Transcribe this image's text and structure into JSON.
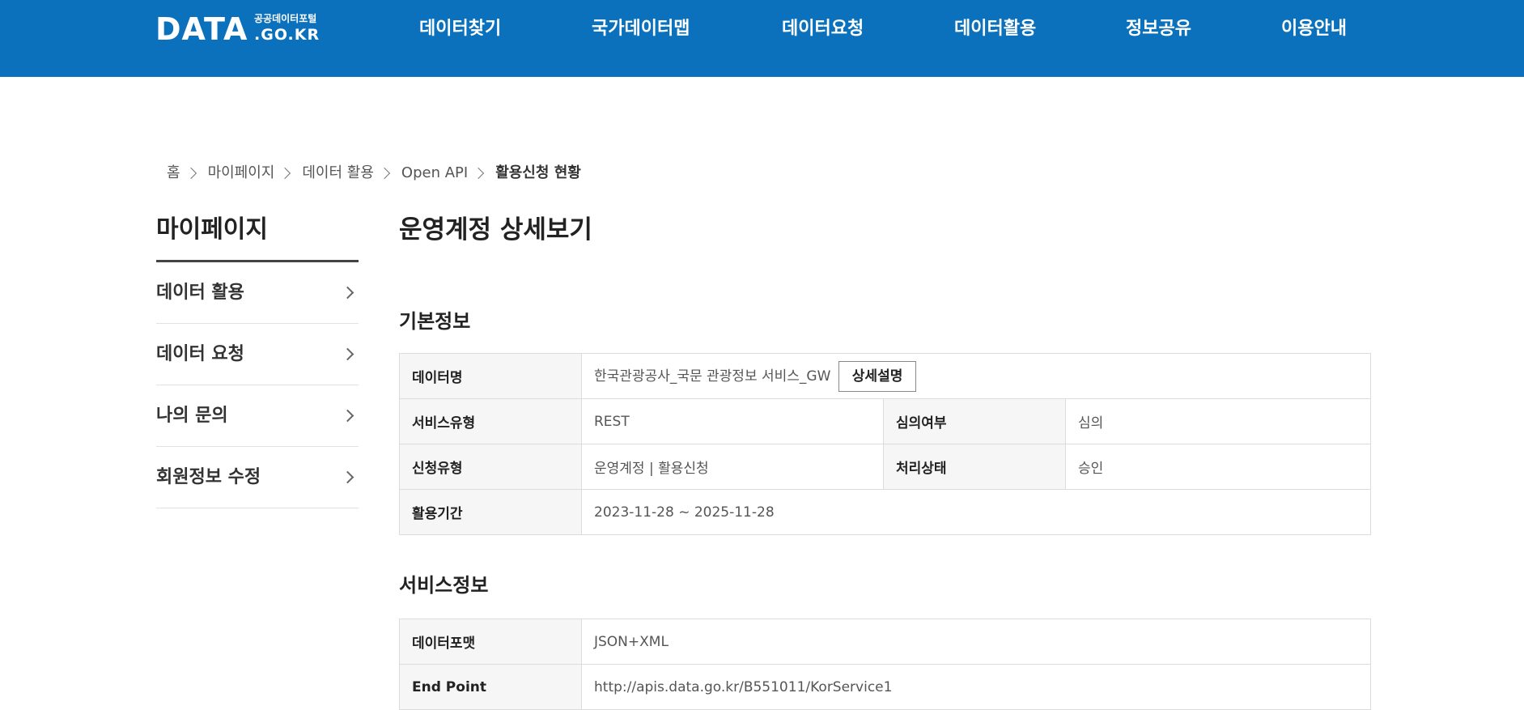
{
  "header": {
    "logo_main": "DATA",
    "logo_sub": "공공데이터포털",
    "logo_domain": ".GO.KR",
    "nav": [
      "데이터찾기",
      "국가데이터맵",
      "데이터요청",
      "데이터활용",
      "정보공유",
      "이용안내"
    ]
  },
  "breadcrumb": [
    "홈",
    "마이페이지",
    "데이터 활용",
    "Open API",
    "활용신청 현황"
  ],
  "sidebar": {
    "title": "마이페이지",
    "items": [
      "데이터 활용",
      "데이터 요청",
      "나의 문의",
      "회원정보 수정"
    ]
  },
  "main": {
    "title": "운영계정 상세보기",
    "basic": {
      "title": "기본정보",
      "data_name_label": "데이터명",
      "data_name": "한국관광공사_국문 관광정보 서비스_GW",
      "detail_button": "상세설명",
      "service_type_label": "서비스유형",
      "service_type": "REST",
      "review_label": "심의여부",
      "review": "심의",
      "apply_type_label": "신청유형",
      "apply_type": "운영계정 | 활용신청",
      "status_label": "처리상태",
      "status": "승인",
      "period_label": "활용기간",
      "period": "2023-11-28 ~ 2025-11-28"
    },
    "service": {
      "title": "서비스정보",
      "format_label": "데이터포맷",
      "format": "JSON+XML",
      "endpoint_label": "End Point",
      "endpoint": "http://apis.data.go.kr/B551011/KorService1"
    }
  },
  "colors": {
    "header_bg": "#0b71bd",
    "table_header_bg": "#f6f6f6",
    "border": "#dcdcdc"
  }
}
